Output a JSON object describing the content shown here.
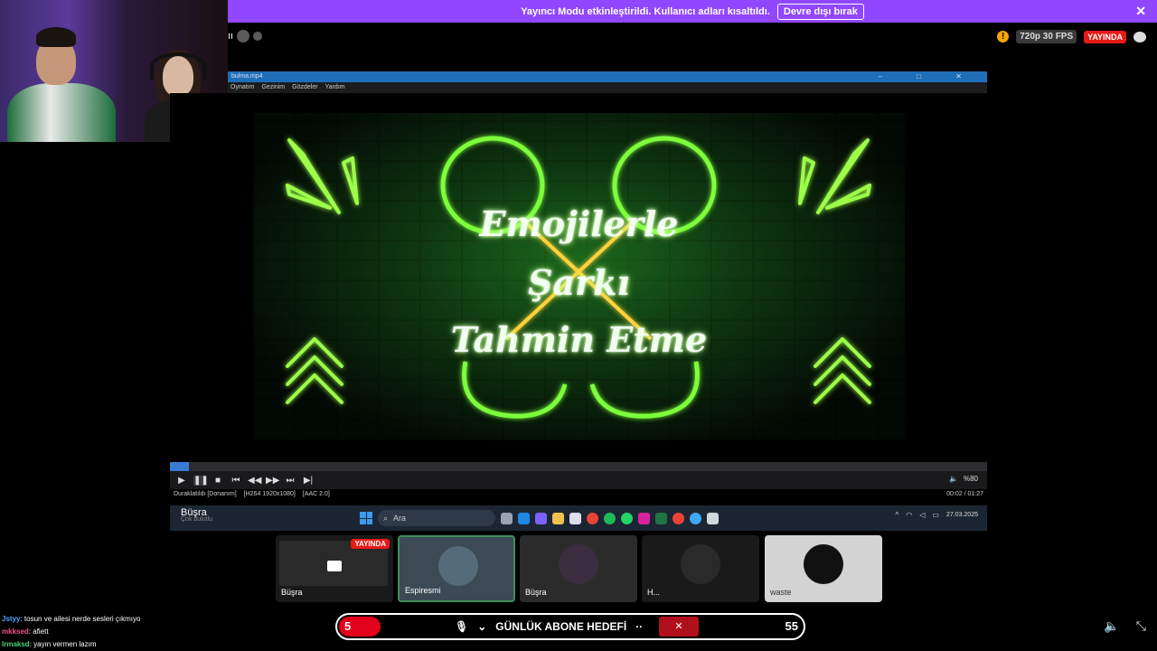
{
  "banner": {
    "message": "Yayıncı Modu etkinleştirildi. Kullanıcı adları kısaltıldı.",
    "button_label": "Devre dışı bırak",
    "close_glyph": "✕"
  },
  "stream": {
    "top_left_text": "ıı",
    "quality": "720p 30 FPS",
    "live_label": "YAYINDA",
    "warn_glyph": "!"
  },
  "player": {
    "window_title": "bulma.mp4",
    "window_controls": "‒ □ ✕",
    "menu": [
      "Oynatım",
      "Gezinim",
      "Gözdeler",
      "Yardım"
    ],
    "video_title_lines": [
      "Emojilerle",
      "Şarkı",
      "Tahmin Etme"
    ],
    "progress": 0.023,
    "controls": [
      "▶",
      "❚❚",
      "■",
      "⏮",
      "◀◀",
      "▶▶",
      "⏭",
      "▶|"
    ],
    "volume_icon": "🔈",
    "volume": "%80",
    "status_items": [
      "Duraklatıldı [Donanım]",
      "[H264 1920x1080]",
      "[AAC 2.0]"
    ],
    "time": "00:02 / 01:27"
  },
  "taskbar": {
    "user_name": "Büşra",
    "user_status": "Çok bulutlu",
    "search_placeholder": "Ara",
    "date": "27.03.2025",
    "tray_caret": "^"
  },
  "tiles": [
    {
      "name": "Büşra",
      "badge": "YAYINDA"
    },
    {
      "name": "Espiresmi"
    },
    {
      "name": "Büşra"
    },
    {
      "name": "H..."
    },
    {
      "name": "waste"
    }
  ],
  "chat": [
    {
      "user": "Jstyy",
      "text": ": tosun ve ailesi nerde sesleri çıkmıyo",
      "color": "#4aa3ff"
    },
    {
      "user": "mkksed",
      "text": ": afiett",
      "color": "#ff4f8b"
    },
    {
      "user": "lrmaksd",
      "text": ": yayın vermen lazım",
      "color": "#43d17a"
    }
  ],
  "goal": {
    "current": "5",
    "label": "GÜNLÜK ABONE HEDEFİ",
    "target": "55",
    "mic_glyph": "🎙",
    "chevron_glyph": "⌄",
    "dots": "··"
  },
  "colors": {
    "banner": "#9147ff",
    "live": "#e91916",
    "neon_green": "#7dff3a",
    "neon_yellow": "#ffd23a"
  }
}
